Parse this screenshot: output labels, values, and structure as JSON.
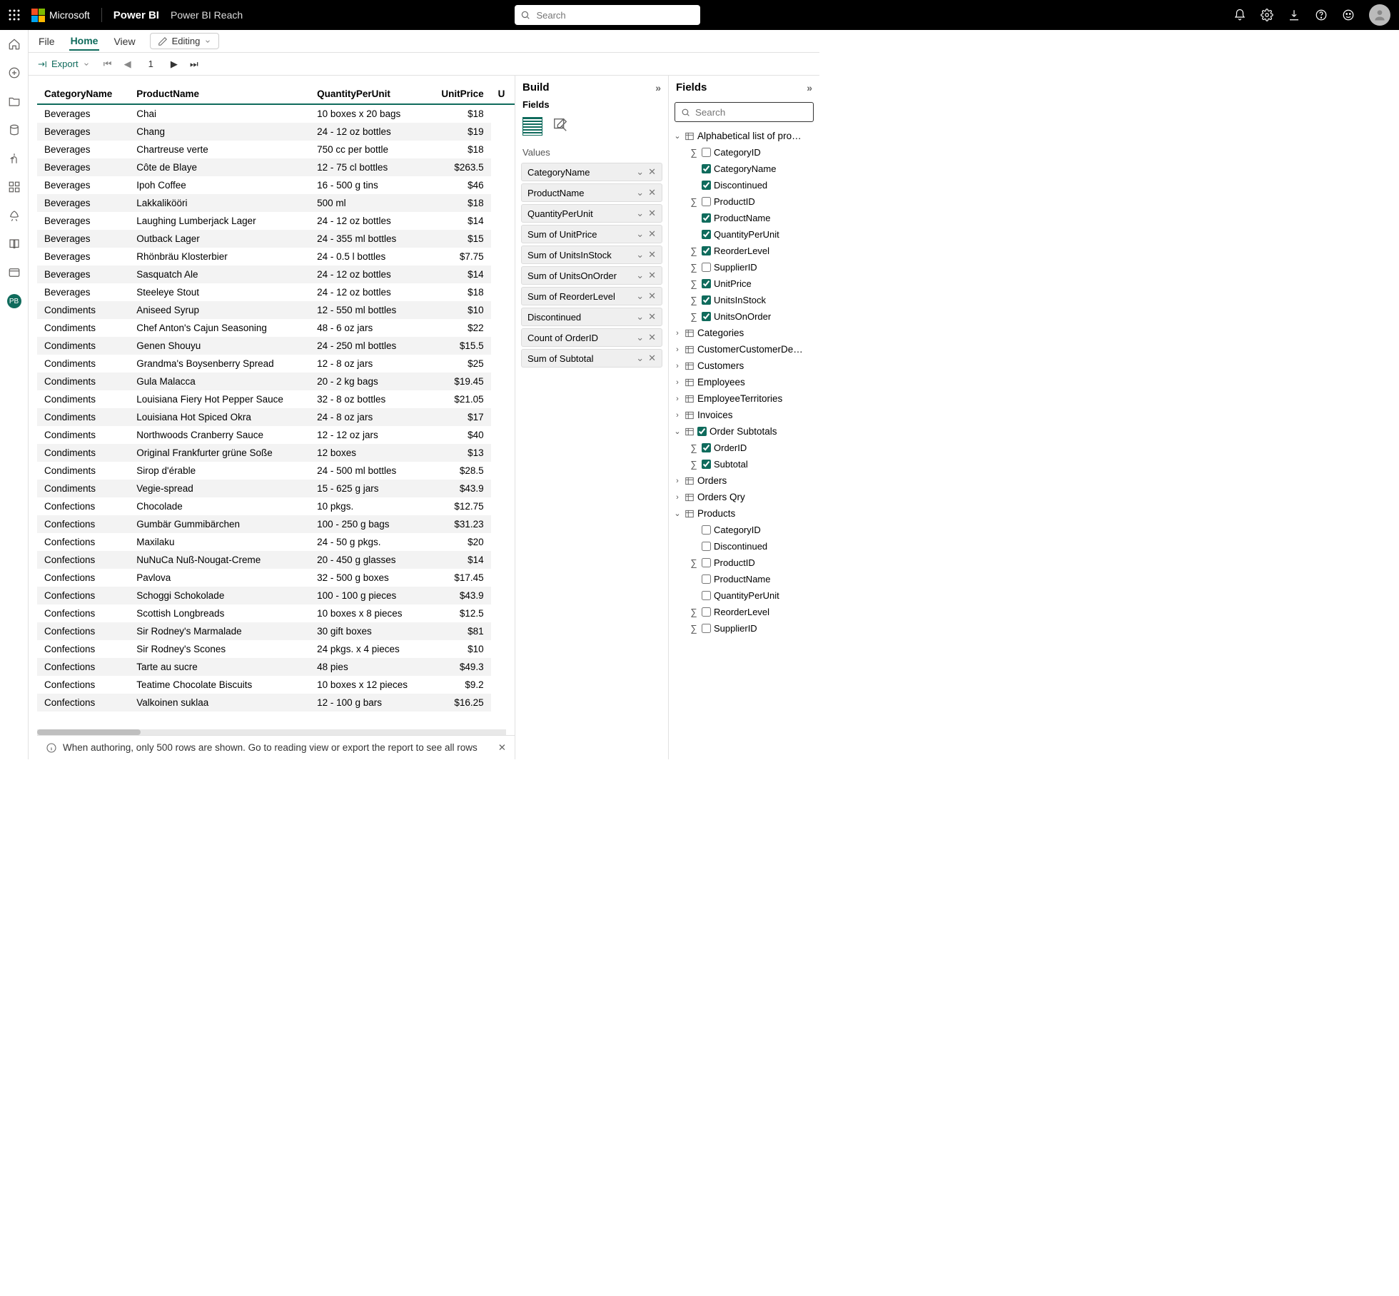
{
  "header": {
    "ms": "Microsoft",
    "product": "Power BI",
    "workspace": "Power BI Reach",
    "search_placeholder": "Search"
  },
  "ribbon": {
    "file": "File",
    "home": "Home",
    "view": "View",
    "editing": "Editing"
  },
  "toolbar": {
    "export": "Export",
    "page": "1"
  },
  "table": {
    "columns": [
      "CategoryName",
      "ProductName",
      "QuantityPerUnit",
      "UnitPrice",
      "U"
    ],
    "rows": [
      [
        "Beverages",
        "Chai",
        "10 boxes x 20 bags",
        "$18"
      ],
      [
        "Beverages",
        "Chang",
        "24 - 12 oz bottles",
        "$19"
      ],
      [
        "Beverages",
        "Chartreuse verte",
        "750 cc per bottle",
        "$18"
      ],
      [
        "Beverages",
        "Côte de Blaye",
        "12 - 75 cl bottles",
        "$263.5"
      ],
      [
        "Beverages",
        "Ipoh Coffee",
        "16 - 500 g tins",
        "$46"
      ],
      [
        "Beverages",
        "Lakkalikööri",
        "500 ml",
        "$18"
      ],
      [
        "Beverages",
        "Laughing Lumberjack Lager",
        "24 - 12 oz bottles",
        "$14"
      ],
      [
        "Beverages",
        "Outback Lager",
        "24 - 355 ml bottles",
        "$15"
      ],
      [
        "Beverages",
        "Rhönbräu Klosterbier",
        "24 - 0.5 l bottles",
        "$7.75"
      ],
      [
        "Beverages",
        "Sasquatch Ale",
        "24 - 12 oz bottles",
        "$14"
      ],
      [
        "Beverages",
        "Steeleye Stout",
        "24 - 12 oz bottles",
        "$18"
      ],
      [
        "Condiments",
        "Aniseed Syrup",
        "12 - 550 ml bottles",
        "$10"
      ],
      [
        "Condiments",
        "Chef Anton's Cajun Seasoning",
        "48 - 6 oz jars",
        "$22"
      ],
      [
        "Condiments",
        "Genen Shouyu",
        "24 - 250 ml bottles",
        "$15.5"
      ],
      [
        "Condiments",
        "Grandma's Boysenberry Spread",
        "12 - 8 oz jars",
        "$25"
      ],
      [
        "Condiments",
        "Gula Malacca",
        "20 - 2 kg bags",
        "$19.45"
      ],
      [
        "Condiments",
        "Louisiana Fiery Hot Pepper Sauce",
        "32 - 8 oz bottles",
        "$21.05"
      ],
      [
        "Condiments",
        "Louisiana Hot Spiced Okra",
        "24 - 8 oz jars",
        "$17"
      ],
      [
        "Condiments",
        "Northwoods Cranberry Sauce",
        "12 - 12 oz jars",
        "$40"
      ],
      [
        "Condiments",
        "Original Frankfurter grüne Soße",
        "12 boxes",
        "$13"
      ],
      [
        "Condiments",
        "Sirop d'érable",
        "24 - 500 ml bottles",
        "$28.5"
      ],
      [
        "Condiments",
        "Vegie-spread",
        "15 - 625 g jars",
        "$43.9"
      ],
      [
        "Confections",
        "Chocolade",
        "10 pkgs.",
        "$12.75"
      ],
      [
        "Confections",
        "Gumbär Gummibärchen",
        "100 - 250 g bags",
        "$31.23"
      ],
      [
        "Confections",
        "Maxilaku",
        "24 - 50 g pkgs.",
        "$20"
      ],
      [
        "Confections",
        "NuNuCa Nuß-Nougat-Creme",
        "20 - 450 g glasses",
        "$14"
      ],
      [
        "Confections",
        "Pavlova",
        "32 - 500 g boxes",
        "$17.45"
      ],
      [
        "Confections",
        "Schoggi Schokolade",
        "100 - 100 g pieces",
        "$43.9"
      ],
      [
        "Confections",
        "Scottish Longbreads",
        "10 boxes x 8 pieces",
        "$12.5"
      ],
      [
        "Confections",
        "Sir Rodney's Marmalade",
        "30 gift boxes",
        "$81"
      ],
      [
        "Confections",
        "Sir Rodney's Scones",
        "24 pkgs. x 4 pieces",
        "$10"
      ],
      [
        "Confections",
        "Tarte au sucre",
        "48 pies",
        "$49.3"
      ],
      [
        "Confections",
        "Teatime Chocolate Biscuits",
        "10 boxes x 12 pieces",
        "$9.2"
      ],
      [
        "Confections",
        "Valkoinen suklaa",
        "12 - 100 g bars",
        "$16.25"
      ]
    ]
  },
  "notice": "When authoring, only 500 rows are shown. Go to reading view or export the report to see all rows",
  "build": {
    "title": "Build",
    "fields_label": "Fields",
    "values_label": "Values",
    "values": [
      "CategoryName",
      "ProductName",
      "QuantityPerUnit",
      "Sum of UnitPrice",
      "Sum of UnitsInStock",
      "Sum of UnitsOnOrder",
      "Sum of ReorderLevel",
      "Discontinued",
      "Count of OrderID",
      "Sum of Subtotal"
    ]
  },
  "fields_panel": {
    "title": "Fields",
    "search_placeholder": "Search",
    "tree": [
      {
        "type": "table",
        "label": "Alphabetical list of pro…",
        "expanded": true,
        "children": [
          {
            "label": "CategoryID",
            "sigma": true,
            "checked": false
          },
          {
            "label": "CategoryName",
            "sigma": false,
            "checked": true
          },
          {
            "label": "Discontinued",
            "sigma": false,
            "checked": true
          },
          {
            "label": "ProductID",
            "sigma": true,
            "checked": false
          },
          {
            "label": "ProductName",
            "sigma": false,
            "checked": true
          },
          {
            "label": "QuantityPerUnit",
            "sigma": false,
            "checked": true
          },
          {
            "label": "ReorderLevel",
            "sigma": true,
            "checked": true
          },
          {
            "label": "SupplierID",
            "sigma": true,
            "checked": false
          },
          {
            "label": "UnitPrice",
            "sigma": true,
            "checked": true
          },
          {
            "label": "UnitsInStock",
            "sigma": true,
            "checked": true
          },
          {
            "label": "UnitsOnOrder",
            "sigma": true,
            "checked": true
          }
        ]
      },
      {
        "type": "table",
        "label": "Categories",
        "expanded": false
      },
      {
        "type": "table",
        "label": "CustomerCustomerDe…",
        "expanded": false
      },
      {
        "type": "table",
        "label": "Customers",
        "expanded": false
      },
      {
        "type": "table",
        "label": "Employees",
        "expanded": false
      },
      {
        "type": "table",
        "label": "EmployeeTerritories",
        "expanded": false
      },
      {
        "type": "table",
        "label": "Invoices",
        "expanded": false
      },
      {
        "type": "table",
        "label": "Order Subtotals",
        "expanded": true,
        "checked": true,
        "children": [
          {
            "label": "OrderID",
            "sigma": true,
            "checked": true
          },
          {
            "label": "Subtotal",
            "sigma": true,
            "checked": true
          }
        ]
      },
      {
        "type": "table",
        "label": "Orders",
        "expanded": false
      },
      {
        "type": "table",
        "label": "Orders Qry",
        "expanded": false
      },
      {
        "type": "table",
        "label": "Products",
        "expanded": true,
        "children": [
          {
            "label": "CategoryID",
            "sigma": false,
            "checked": false
          },
          {
            "label": "Discontinued",
            "sigma": false,
            "checked": false
          },
          {
            "label": "ProductID",
            "sigma": true,
            "checked": false
          },
          {
            "label": "ProductName",
            "sigma": false,
            "checked": false
          },
          {
            "label": "QuantityPerUnit",
            "sigma": false,
            "checked": false
          },
          {
            "label": "ReorderLevel",
            "sigma": true,
            "checked": false
          },
          {
            "label": "SupplierID",
            "sigma": true,
            "checked": false
          }
        ]
      }
    ]
  },
  "rail_badge": "PB"
}
